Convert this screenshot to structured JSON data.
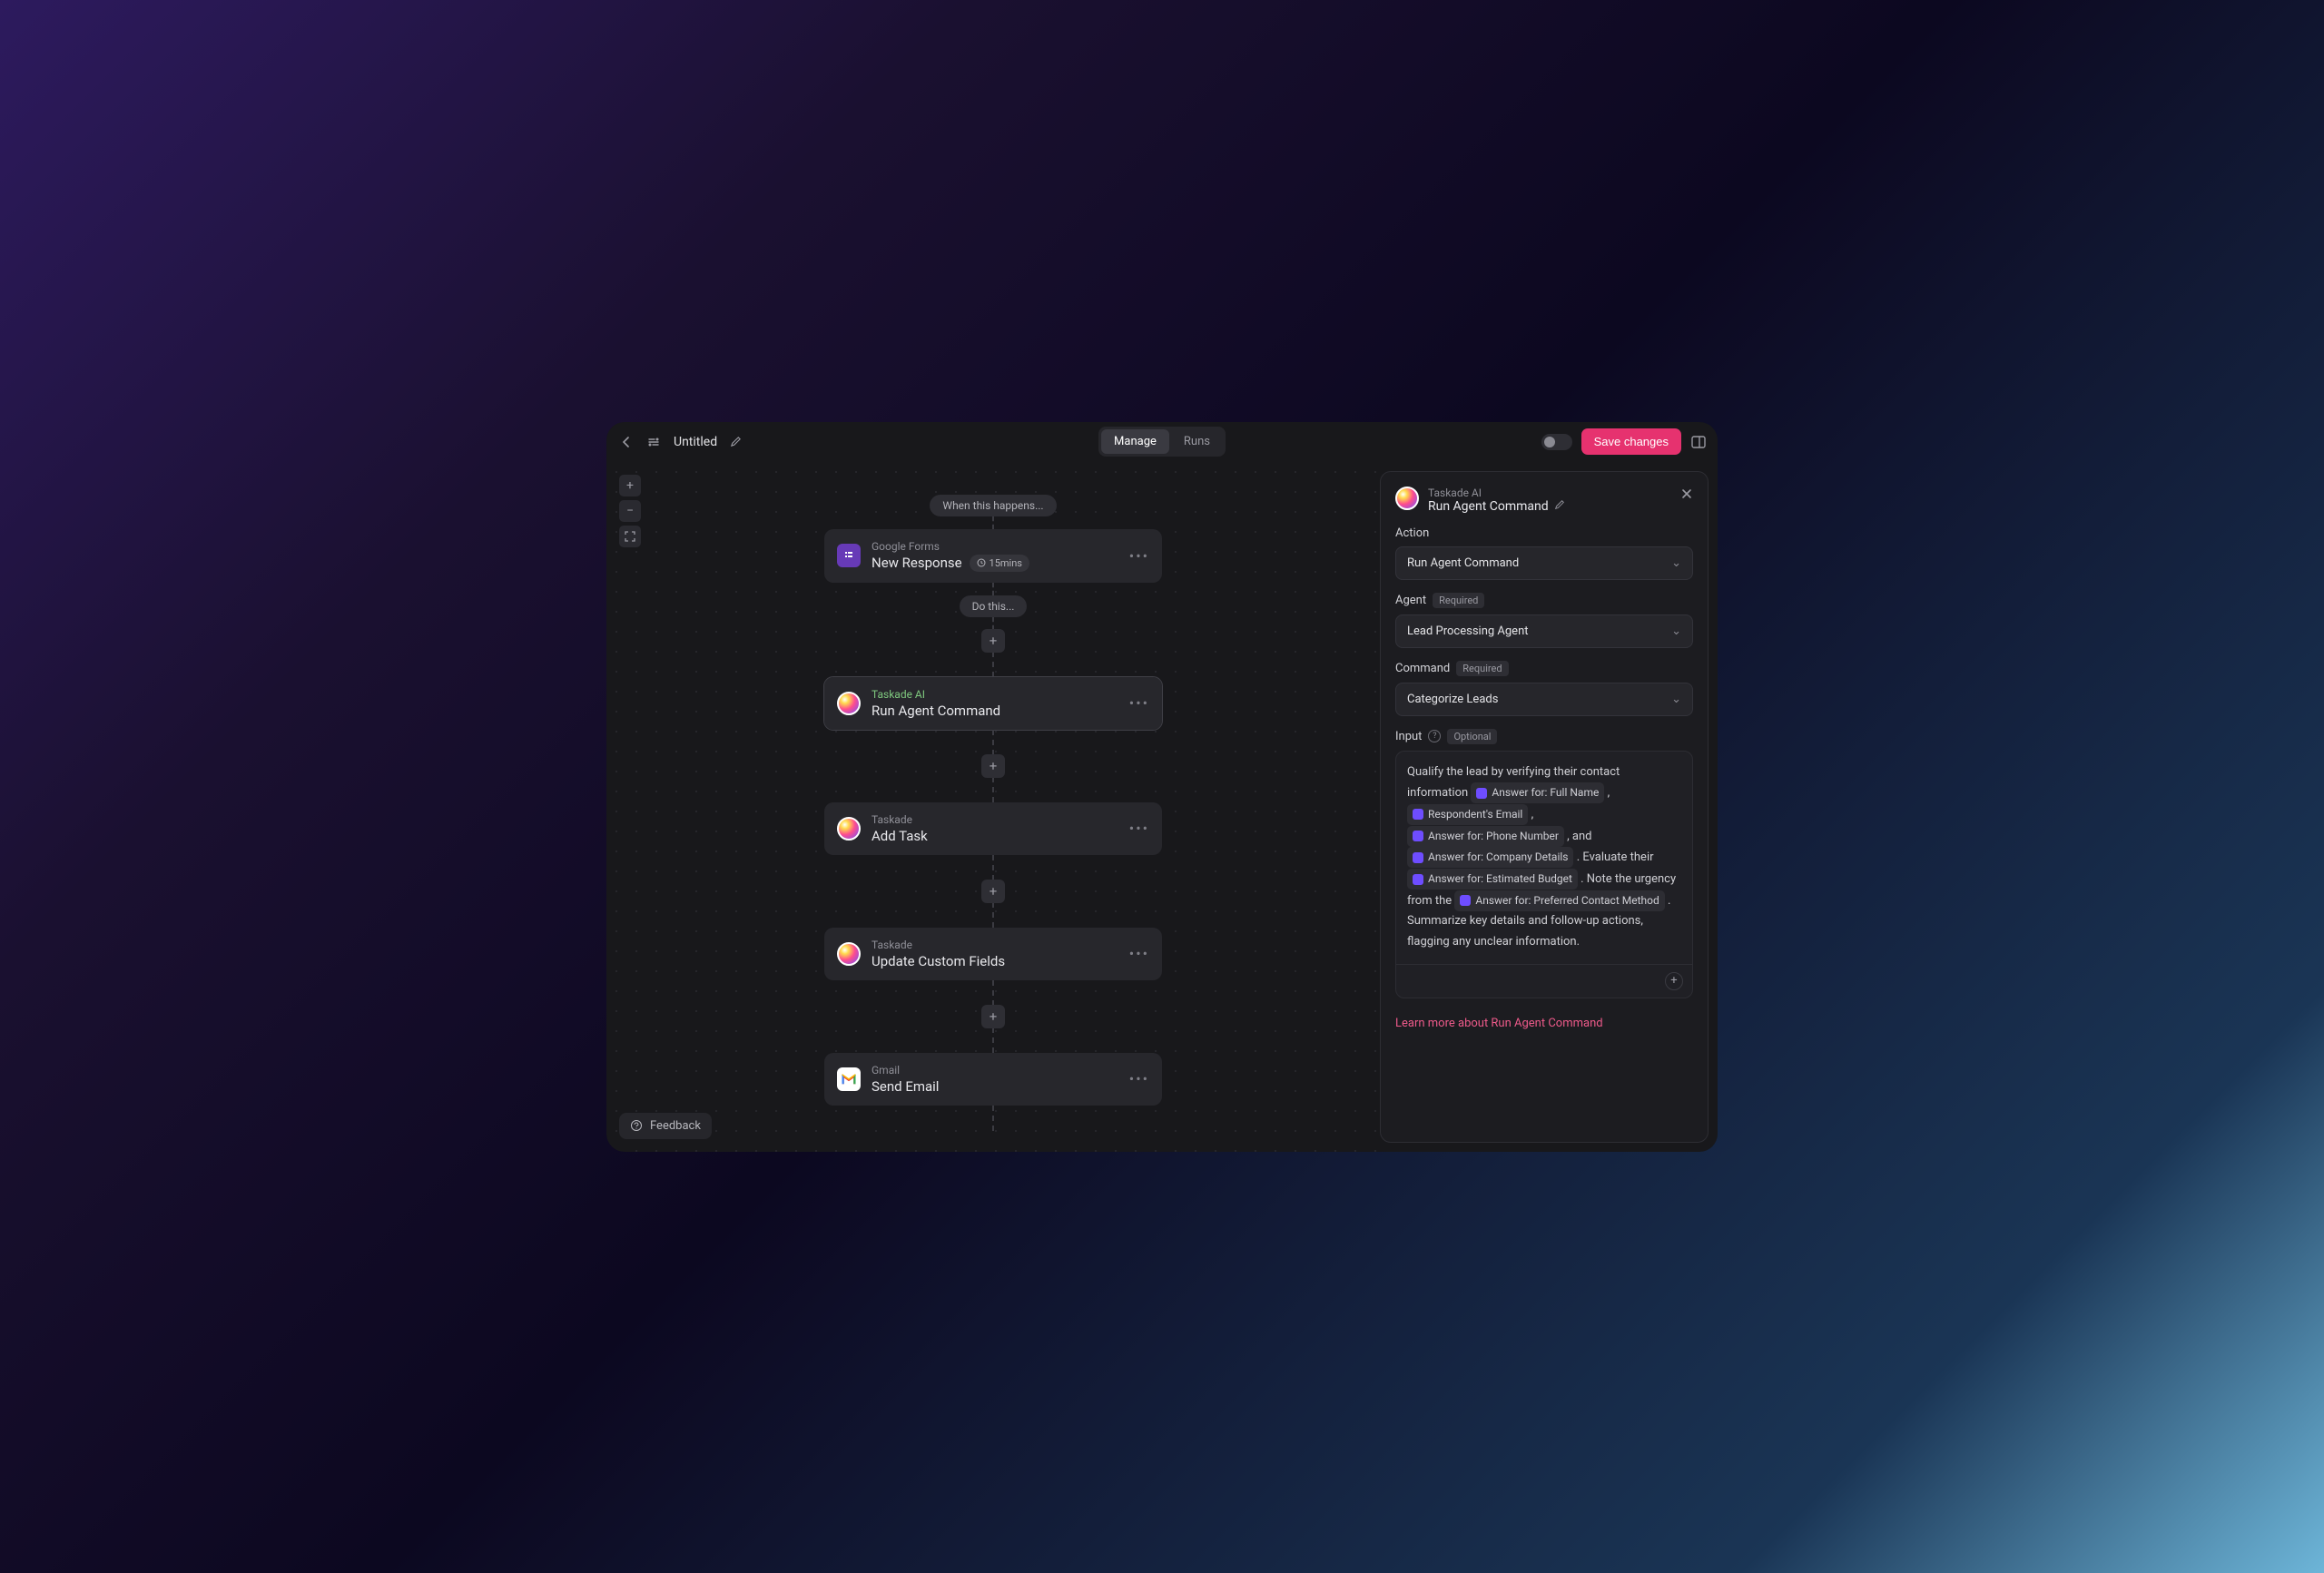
{
  "header": {
    "title": "Untitled",
    "tabs": {
      "manage": "Manage",
      "runs": "Runs"
    },
    "save": "Save changes"
  },
  "canvas": {
    "triggerLabel": "When this happens...",
    "doLabel": "Do this...",
    "feedback": "Feedback",
    "nodes": [
      {
        "app": "Google Forms",
        "title": "New Response",
        "badge": "15mins"
      },
      {
        "app": "Taskade AI",
        "title": "Run Agent Command"
      },
      {
        "app": "Taskade",
        "title": "Add Task"
      },
      {
        "app": "Taskade",
        "title": "Update Custom Fields"
      },
      {
        "app": "Gmail",
        "title": "Send Email"
      }
    ]
  },
  "panel": {
    "app": "Taskade AI",
    "title": "Run Agent Command",
    "fields": {
      "action": {
        "label": "Action",
        "value": "Run Agent Command"
      },
      "agent": {
        "label": "Agent",
        "tag": "Required",
        "value": "Lead Processing Agent"
      },
      "command": {
        "label": "Command",
        "tag": "Required",
        "value": "Categorize Leads"
      },
      "input": {
        "label": "Input",
        "tag": "Optional"
      }
    },
    "inputText": {
      "p1": "Qualify the lead by verifying their contact information ",
      "chip1": "Answer for: Full Name",
      "s1": " , ",
      "chip2": "Respondent's Email",
      "s2": " , ",
      "chip3": "Answer for: Phone Number",
      "s3": " , and ",
      "chip4": "Answer for: Company Details",
      "s4": " . Evaluate their ",
      "chip5": "Answer for: Estimated Budget",
      "s5": " . Note the urgency from the ",
      "chip6": "Answer for: Preferred Contact Method",
      "s6": " . Summarize key details and follow-up actions, flagging any unclear information."
    },
    "learn": "Learn more about Run Agent Command"
  }
}
